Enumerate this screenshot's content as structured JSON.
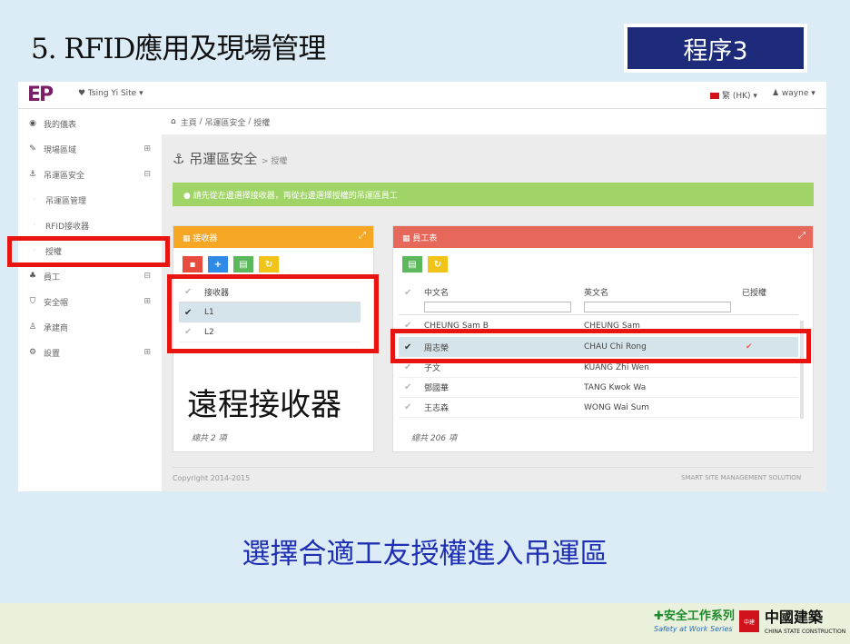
{
  "slide": {
    "title": "5. RFID應用及現場管理",
    "step_badge": "程序3",
    "overlay_label": "遠程接收器",
    "caption": "選擇合適工友授權進入吊運區"
  },
  "topbar": {
    "logo": "EP",
    "site_select": "♥ Tsing Yi Site ▾",
    "lang_select": "繁 (HK) ▾",
    "user_select": "♟ wayne ▾"
  },
  "sidebar": {
    "items": [
      {
        "icon": "dashboard-icon",
        "glyph": "◉",
        "label": "我的儀表",
        "expand": ""
      },
      {
        "icon": "cogs-icon",
        "glyph": "✎",
        "label": "現場區域",
        "expand": "⊞"
      },
      {
        "icon": "crane-icon",
        "glyph": "⚓",
        "label": "吊運區安全",
        "expand": "⊟"
      },
      {
        "icon": "sub-dot-icon",
        "glyph": "·",
        "label": "吊運區管理",
        "expand": ""
      },
      {
        "icon": "sub-dot-icon",
        "glyph": "·",
        "label": "RFID接收器",
        "expand": ""
      },
      {
        "icon": "sub-dot-icon",
        "glyph": "·",
        "label": "授權",
        "expand": ""
      },
      {
        "icon": "users-icon",
        "glyph": "♣",
        "label": "員工",
        "expand": "⊟"
      },
      {
        "icon": "shield-icon",
        "glyph": "⛉",
        "label": "安全帽",
        "expand": "⊞"
      },
      {
        "icon": "person-icon",
        "glyph": "♙",
        "label": "承建商",
        "expand": ""
      },
      {
        "icon": "settings-icon",
        "glyph": "⚙",
        "label": "設置",
        "expand": "⊞"
      }
    ]
  },
  "breadcrumb": {
    "home": "主頁",
    "section": "吊運區安全",
    "page": "授權"
  },
  "page": {
    "heading": "吊運區安全",
    "heading_sub": "> 授權",
    "alert": "● 請先從左邊選擇接收器，再從右邊選擇授權的吊運區員工"
  },
  "left_box": {
    "title": "▦ 接收器",
    "column": "接收器",
    "rows": [
      "L1",
      "L2"
    ],
    "selected_index": 0,
    "footer": "總共 2 項",
    "buttons": [
      {
        "icon": "delete-icon",
        "glyph": "▪",
        "color": "#e84c3d"
      },
      {
        "icon": "add-icon",
        "glyph": "+",
        "color": "#2f8be6"
      },
      {
        "icon": "export-icon",
        "glyph": "▤",
        "color": "#5cb85c"
      },
      {
        "icon": "refresh-icon",
        "glyph": "↻",
        "color": "#f0c419"
      }
    ]
  },
  "right_box": {
    "title": "▦ 員工表",
    "columns": [
      "中文名",
      "英文名",
      "已授權"
    ],
    "rows": [
      {
        "cn": "CHEUNG Sam B",
        "en": "CHEUNG Sam",
        "auth": ""
      },
      {
        "cn": "周志榮",
        "en": "CHAU Chi Rong",
        "auth": "✔"
      },
      {
        "cn": "子文",
        "en": "KUANG Zhi Wen",
        "auth": ""
      },
      {
        "cn": "鄧國華",
        "en": "TANG Kwok Wa",
        "auth": ""
      },
      {
        "cn": "王志森",
        "en": "WONG Wai Sum",
        "auth": ""
      }
    ],
    "selected_index": 1,
    "footer": "總共 206 項",
    "buttons": [
      {
        "icon": "export-icon",
        "glyph": "▤",
        "color": "#5cb85c"
      },
      {
        "icon": "refresh-icon",
        "glyph": "↻",
        "color": "#f0c419"
      }
    ]
  },
  "footer": {
    "copyright": "Copyright 2014-2015",
    "solution": "SMART SITE MANAGEMENT SOLUTION"
  },
  "branding": {
    "safety_cn": "✚安全工作系列",
    "safety_en": "Safety at Work Series",
    "csc_mark": "中建",
    "csc_cn": "中國建築",
    "csc_en": "CHINA STATE CONSTRUCTION"
  },
  "colors": {
    "accent_orange": "#f5a623",
    "accent_red_header": "#e5685a",
    "alert_green": "#a1d467",
    "highlight_red": "#e8140f",
    "caption_blue": "#1f2fb3",
    "badge_navy": "#1d2b7a"
  }
}
